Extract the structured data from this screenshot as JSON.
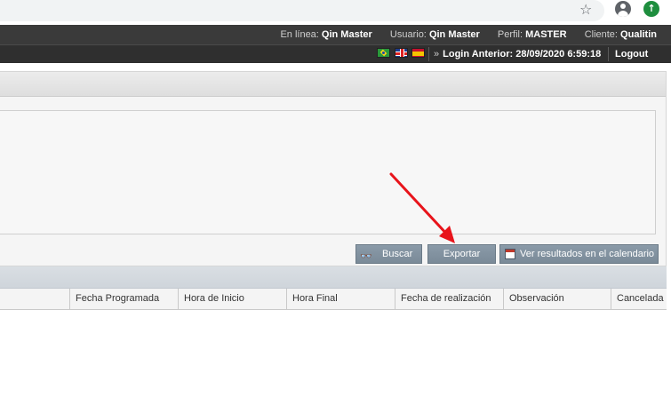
{
  "header": {
    "online_label": "En línea:",
    "online_value": "Qin Master",
    "user_label": "Usuario:",
    "user_value": "Qin Master",
    "profile_label": "Perfil:",
    "profile_value": "MASTER",
    "client_label": "Cliente:",
    "client_value": "Qualitin",
    "last_login": "Login Anterior: 28/09/2020 6:59:18",
    "last_login_chevron": "»",
    "logout_label": "Logout",
    "flags": [
      "brazil-flag-icon",
      "uk-flag-icon",
      "spain-flag-icon"
    ]
  },
  "browser": {
    "star": "☆",
    "update": "↑"
  },
  "toolbar": {
    "search_label": "Buscar",
    "search_icon": "binoculars-icon",
    "export_label": "Exportar",
    "calendar_label": "Ver resultados en el calendario",
    "calendar_icon": "calendar-icon"
  },
  "table": {
    "columns": [
      "Fecha Programada",
      "Hora de Inicio",
      "Hora Final",
      "Fecha de realización",
      "Observación",
      "Cancelada"
    ]
  },
  "colors": {
    "header_bg": "#3a3a3a",
    "button_bg": "#8a9aa8",
    "annotation_arrow": "#e8141b"
  }
}
